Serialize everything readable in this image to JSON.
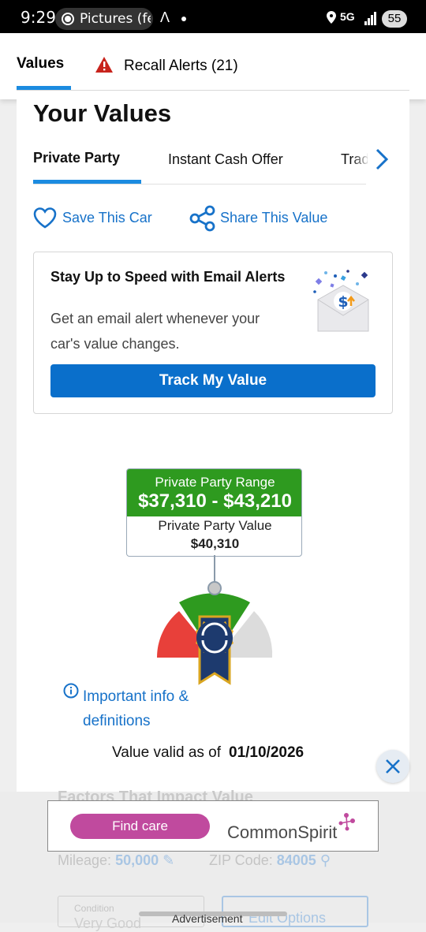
{
  "status_bar": {
    "time": "9:29",
    "notification": "Pictures (fe",
    "network": "5G",
    "battery": "55"
  },
  "top_tabs": [
    {
      "label": "Values",
      "active": true
    },
    {
      "label": "Recall Alerts (21)",
      "active": false
    }
  ],
  "main": {
    "title": "Your Values",
    "sub_tabs": [
      {
        "label": "Private Party",
        "active": true
      },
      {
        "label": "Instant Cash Offer",
        "active": false
      },
      {
        "label": "Trade",
        "active": false
      }
    ],
    "save_label": "Save This Car",
    "share_label": "Share This Value"
  },
  "alert": {
    "title": "Stay Up to Speed with Email Alerts",
    "description": "Get an email alert whenever your car's value changes.",
    "button_label": "Track My Value"
  },
  "value_box": {
    "range_label": "Private Party Range",
    "range_value": "$37,310 - $43,210",
    "value_label": "Private Party Value",
    "value": "$40,310"
  },
  "info": {
    "link_label": "Important info & definitions",
    "valid_label": "Value valid as of",
    "valid_date": "01/10/2026"
  },
  "obscured": {
    "factors_title": "Factors That Impact Value",
    "mileage_label": "Mileage:",
    "mileage_value": "50,000",
    "zip_label": "ZIP Code:",
    "zip_value": "84005",
    "condition_label": "Condition",
    "condition_value": "Very Good",
    "edit_label": "Edit Options"
  },
  "ad": {
    "button_label": "Find care",
    "brand": "CommonSpirit",
    "label": "Advertisement"
  },
  "colors": {
    "accent_blue": "#1b8be0",
    "button_blue": "#0a6fcb",
    "range_green": "#2e9a1f",
    "link_blue": "#1772c9",
    "ad_pink": "#c04a9e"
  }
}
